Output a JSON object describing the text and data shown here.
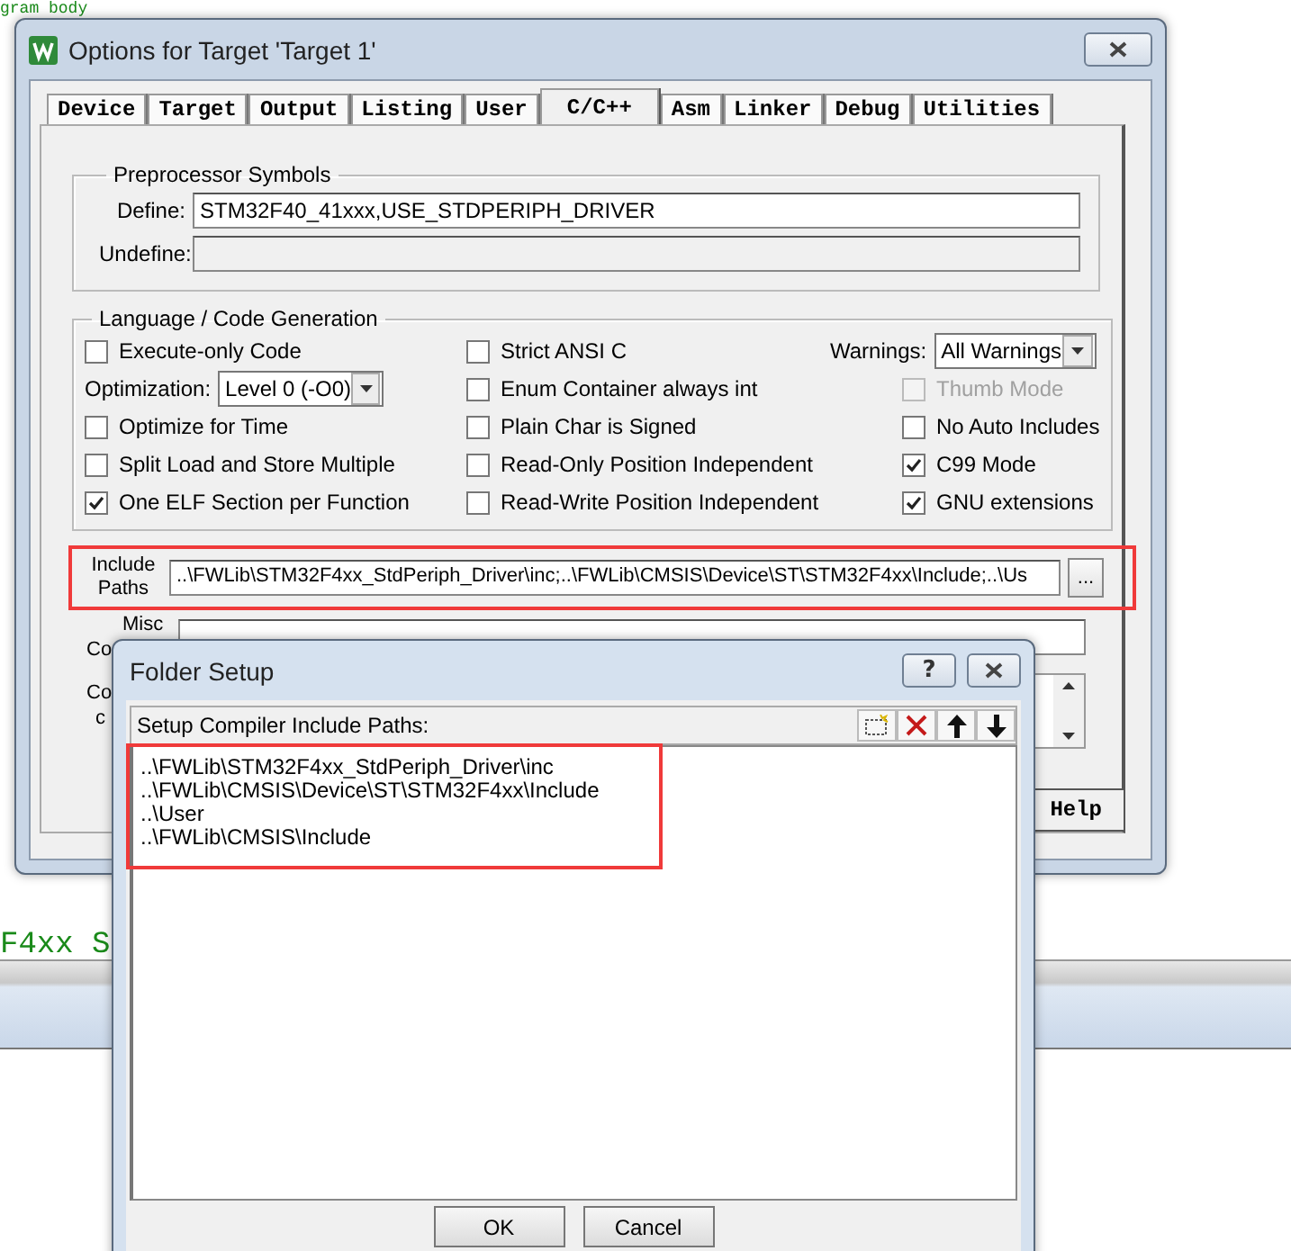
{
  "editor": {
    "lines": [
      {
        "text": "gram body"
      },
      {
        "text": "F4xx S"
      }
    ]
  },
  "options_dialog": {
    "title": "Options for Target 'Target 1'",
    "tabs": [
      {
        "label": "Device",
        "selected": false
      },
      {
        "label": "Target",
        "selected": false
      },
      {
        "label": "Output",
        "selected": false
      },
      {
        "label": "Listing",
        "selected": false
      },
      {
        "label": "User",
        "selected": false
      },
      {
        "label": "C/C++",
        "selected": true
      },
      {
        "label": "Asm",
        "selected": false
      },
      {
        "label": "Linker",
        "selected": false
      },
      {
        "label": "Debug",
        "selected": false
      },
      {
        "label": "Utilities",
        "selected": false
      }
    ],
    "preprocessor": {
      "title": "Preprocessor Symbols",
      "define": {
        "label": "Define:",
        "value": "STM32F40_41xxx,USE_STDPERIPH_DRIVER",
        "disabled": false
      },
      "undefine": {
        "label": "Undefine:",
        "disabled": true
      }
    },
    "codegen": {
      "title": "Language / Code Generation",
      "columns": [
        {
          "items": [
            {
              "kind": "checkbox",
              "label": "Execute-only Code",
              "checked": false,
              "disabled": false
            },
            {
              "kind": "select",
              "label": "Optimization:",
              "value": "Level 0 (-O0)"
            },
            {
              "kind": "checkbox",
              "label": "Optimize for Time",
              "checked": false,
              "disabled": false
            },
            {
              "kind": "checkbox",
              "label": "Split Load and Store Multiple",
              "checked": false,
              "disabled": false
            },
            {
              "kind": "checkbox",
              "label": "One ELF Section per Function",
              "checked": true,
              "disabled": false
            }
          ]
        },
        {
          "items": [
            {
              "kind": "checkbox",
              "label": "Strict ANSI C",
              "checked": false,
              "disabled": false
            },
            {
              "kind": "checkbox",
              "label": "Enum Container always int",
              "checked": false,
              "disabled": false
            },
            {
              "kind": "checkbox",
              "label": "Plain Char is Signed",
              "checked": false,
              "disabled": false
            },
            {
              "kind": "checkbox",
              "label": "Read-Only Position Independent",
              "checked": false,
              "disabled": false
            },
            {
              "kind": "checkbox",
              "label": "Read-Write Position Independent",
              "checked": false,
              "disabled": false
            }
          ]
        },
        {
          "items": [
            {
              "kind": "select",
              "label": "Warnings:",
              "value": "All Warnings"
            },
            {
              "kind": "checkbox",
              "label": "Thumb Mode",
              "checked": false,
              "disabled": true
            },
            {
              "kind": "checkbox",
              "label": "No Auto Includes",
              "checked": false,
              "disabled": false
            },
            {
              "kind": "checkbox",
              "label": "C99 Mode",
              "checked": true,
              "disabled": false
            },
            {
              "kind": "checkbox",
              "label": "GNU extensions",
              "checked": true,
              "disabled": false
            }
          ]
        }
      ]
    },
    "include_paths": {
      "label": "Include Paths",
      "value": "..\\FWLib\\STM32F4xx_StdPeriph_Driver\\inc;..\\FWLib\\CMSIS\\Device\\ST\\STM32F4xx\\Include;..\\Us",
      "browse": "...",
      "highlighted": true
    },
    "misc_controls": {
      "label_lines": [
        "Misc",
        "Co"
      ]
    },
    "compiler_control": {
      "label_lines": [
        "Co",
        "c"
      ]
    },
    "help_button": "Help"
  },
  "folder_dialog": {
    "title": "Folder Setup",
    "help": "?",
    "header": "Setup Compiler Include Paths:",
    "paths": [
      {
        "text": "..\\FWLib\\STM32F4xx_StdPeriph_Driver\\inc"
      },
      {
        "text": "..\\FWLib\\CMSIS\\Device\\ST\\STM32F4xx\\Include"
      },
      {
        "text": "..\\User"
      },
      {
        "text": "..\\FWLib\\CMSIS\\Include"
      }
    ],
    "paths_highlighted": true,
    "buttons": [
      {
        "label": "OK"
      },
      {
        "label": "Cancel"
      }
    ]
  }
}
